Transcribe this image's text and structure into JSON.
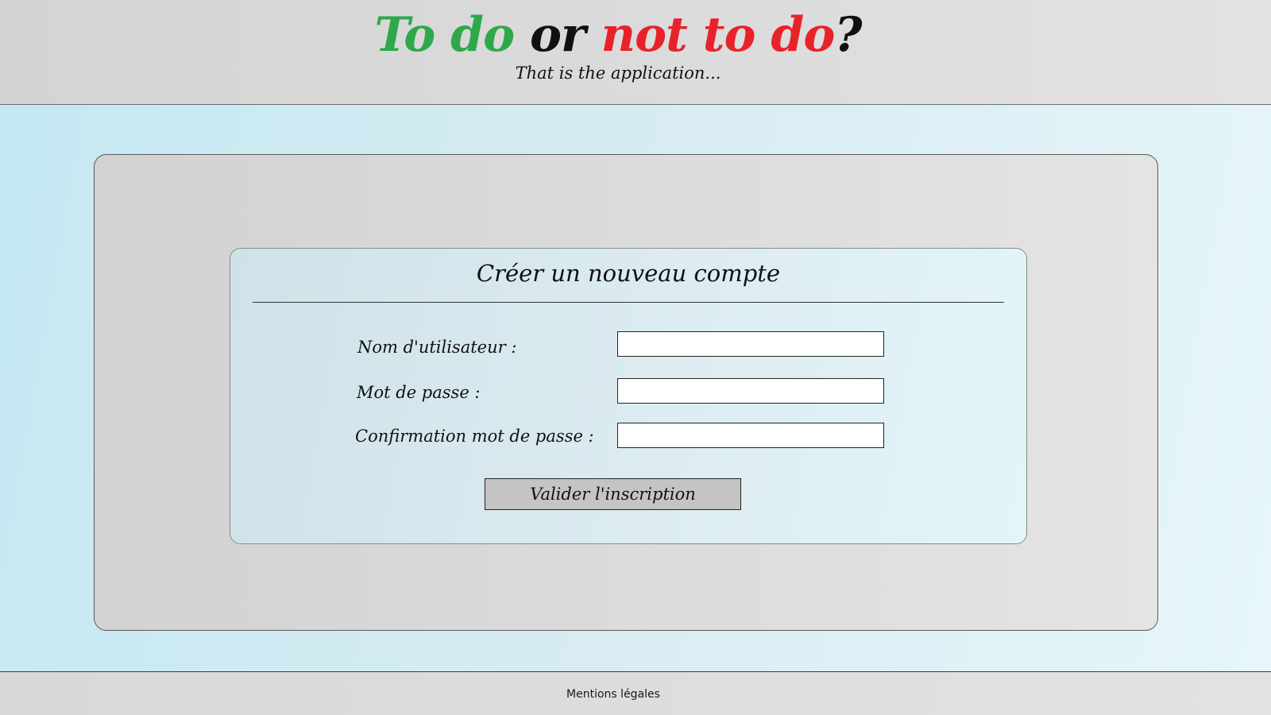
{
  "header": {
    "logo": {
      "part1": "To do",
      "part2": " or ",
      "part3": "not to do",
      "part4": "?",
      "colors": {
        "green": "#2fa84a",
        "black": "#111111",
        "red": "#e8222b"
      }
    },
    "tagline": "That is the application..."
  },
  "form": {
    "title": "Créer un nouveau compte",
    "fields": {
      "username": {
        "label": "Nom d'utilisateur :",
        "value": ""
      },
      "password": {
        "label": "Mot de passe :",
        "value": ""
      },
      "confirm_password": {
        "label": "Confirmation mot de passe :",
        "value": ""
      }
    },
    "submit_label": "Valider l'inscription"
  },
  "footer": {
    "legal_link": "Mentions légales"
  }
}
